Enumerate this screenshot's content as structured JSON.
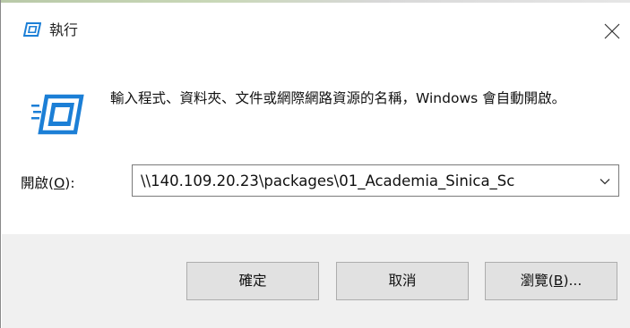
{
  "window": {
    "title": "執行",
    "close_icon": "close-icon",
    "title_icon": "run-icon"
  },
  "content": {
    "description": "輸入程式、資料夾、文件或網際網路資源的名稱，Windows 會自動開啟。",
    "open_label_prefix": "開啟(",
    "open_label_accel": "O",
    "open_label_suffix": "):",
    "open_value": "\\\\140.109.20.23\\packages\\01_Academia_Sinica_Sc"
  },
  "buttons": {
    "ok_label": "確定",
    "cancel_label": "取消",
    "browse_prefix": "瀏覽(",
    "browse_accel": "B",
    "browse_suffix": ")..."
  },
  "colors": {
    "icon_blue": "#1c7fd6",
    "footer_bg": "#f0f0f0",
    "button_bg": "#e1e1e1",
    "button_border": "#adadad"
  }
}
